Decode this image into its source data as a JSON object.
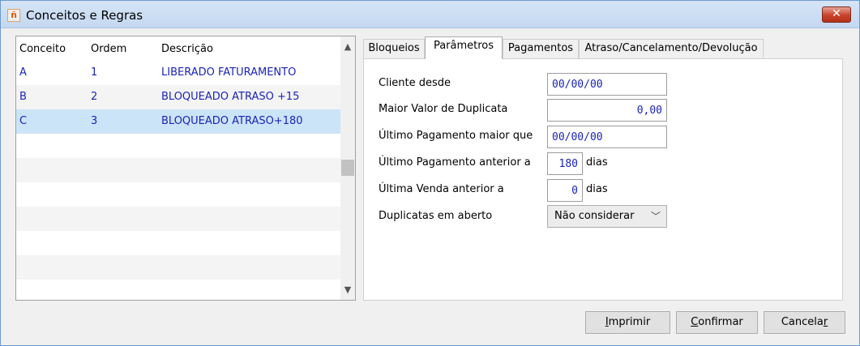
{
  "window": {
    "title": "Conceitos e Regras",
    "close_label": "✕"
  },
  "list": {
    "columns": [
      "Conceito",
      "Ordem",
      "Descrição"
    ],
    "rows": [
      {
        "conceito": "A",
        "ordem": "1",
        "descricao": "LIBERADO FATURAMENTO"
      },
      {
        "conceito": "B",
        "ordem": "2",
        "descricao": "BLOQUEADO ATRASO +15"
      },
      {
        "conceito": "C",
        "ordem": "3",
        "descricao": "BLOQUEADO ATRASO+180"
      }
    ],
    "selected_index": 2,
    "scroll_up_icon": "▲",
    "scroll_down_icon": "▼"
  },
  "tabs": [
    {
      "label": "Bloqueios"
    },
    {
      "label": "Parâmetros"
    },
    {
      "label": "Pagamentos"
    },
    {
      "label": "Atraso/Cancelamento/Devolução"
    }
  ],
  "active_tab": 1,
  "form": {
    "cliente_desde": {
      "label": "Cliente desde",
      "value": "00/00/00"
    },
    "maior_valor": {
      "label": "Maior Valor de Duplicata",
      "value": "0,00"
    },
    "ultimo_pag_maior": {
      "label": "Último Pagamento maior que",
      "value": "00/00/00"
    },
    "ultimo_pag_anterior": {
      "label": "Último Pagamento anterior a",
      "value": "180",
      "unit": "dias"
    },
    "ultima_venda": {
      "label": "Última Venda anterior a",
      "value": "0",
      "unit": "dias"
    },
    "duplicatas": {
      "label": "Duplicatas em aberto",
      "value": "Não considerar"
    }
  },
  "buttons": {
    "imprimir": {
      "before": "",
      "mnemonic": "I",
      "after": "mprimir"
    },
    "confirmar": {
      "before": "",
      "mnemonic": "C",
      "after": "onfirmar"
    },
    "cancelar": {
      "before": "Cancela",
      "mnemonic": "r",
      "after": ""
    }
  },
  "colors": {
    "value_text": "#1a24b4",
    "selection": "#cce4f7",
    "close_button": "#c7432b"
  }
}
